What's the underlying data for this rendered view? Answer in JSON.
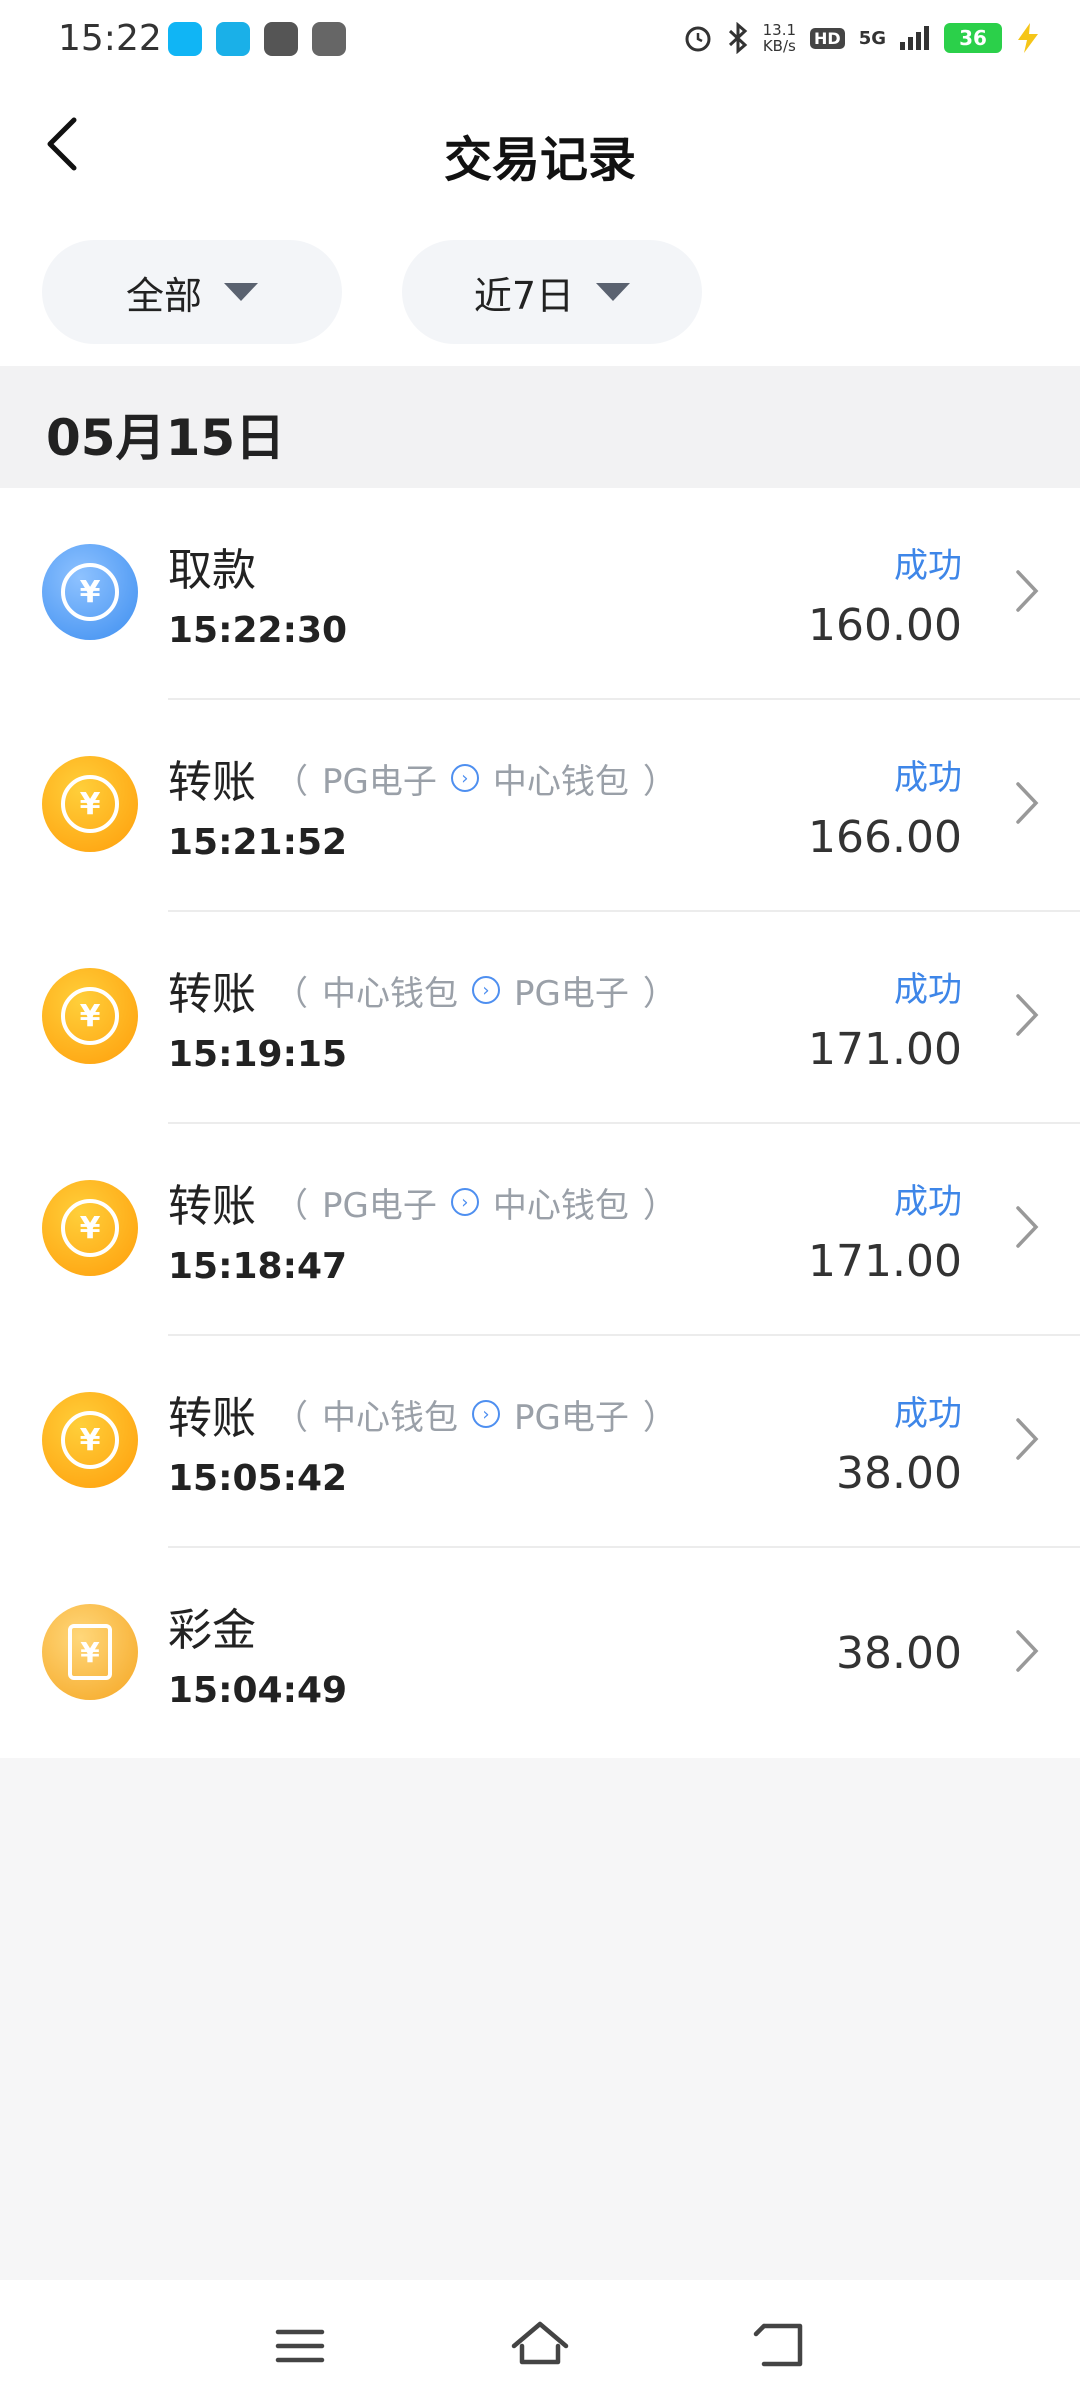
{
  "status_bar": {
    "time": "15:22",
    "speed_value": "13.1",
    "speed_unit": "KB/s",
    "hd": "HD",
    "network": "5G",
    "battery": "36"
  },
  "header": {
    "title": "交易记录"
  },
  "filters": {
    "type": "全部",
    "range": "近7日"
  },
  "date": "05月15日",
  "colors": {
    "accent": "#3e86e8",
    "success": "#3e86e8"
  },
  "rows": [
    {
      "icon": "withdraw-icon",
      "title": "取款",
      "time": "15:22:30",
      "status": "成功",
      "amount": "160.00"
    },
    {
      "icon": "transfer-icon",
      "title": "转账",
      "from": "PG电子",
      "to": "中心钱包",
      "paren_open": "（",
      "paren_close": "）",
      "time": "15:21:52",
      "status": "成功",
      "amount": "166.00"
    },
    {
      "icon": "transfer-icon",
      "title": "转账",
      "from": "中心钱包",
      "to": "PG电子",
      "paren_open": "（",
      "paren_close": "）",
      "time": "15:19:15",
      "status": "成功",
      "amount": "171.00"
    },
    {
      "icon": "transfer-icon",
      "title": "转账",
      "from": "PG电子",
      "to": "中心钱包",
      "paren_open": "（",
      "paren_close": "）",
      "time": "15:18:47",
      "status": "成功",
      "amount": "171.00"
    },
    {
      "icon": "transfer-icon",
      "title": "转账",
      "from": "中心钱包",
      "to": "PG电子",
      "paren_open": "（",
      "paren_close": "）",
      "time": "15:05:42",
      "status": "成功",
      "amount": "38.00"
    },
    {
      "icon": "bonus-icon",
      "title": "彩金",
      "time": "15:04:49",
      "amount": "38.00"
    }
  ],
  "icon_glyphs": {
    "yen": "¥",
    "arrow": "›"
  }
}
